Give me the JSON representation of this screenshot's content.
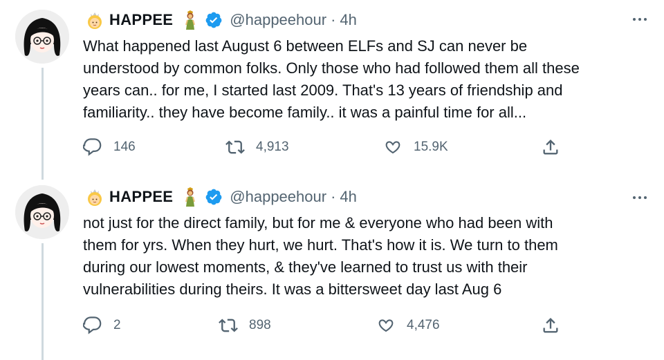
{
  "tweets": [
    {
      "display_name": "HAPPEE",
      "handle": "@happeehour",
      "separator": "·",
      "time": "4h",
      "text": "What happened last August 6 between ELFs and SJ can never be\nunderstood by common folks. Only those who had followed them all these\nyears can.. for me, I started last 2009. That's 13 years of friendship and\nfamiliarity.. they have become family.. it was a painful time for all...",
      "replies": "146",
      "retweets": "4,913",
      "likes": "15.9K"
    },
    {
      "display_name": "HAPPEE",
      "handle": "@happeehour",
      "separator": "·",
      "time": "4h",
      "text": "not just for the direct family, but for me & everyone who had been with\nthem for yrs. When they hurt, we hurt. That's how it is. We turn to them\nduring our lowest moments, & they've learned to trust us with their\nvulnerabilities during theirs. It was a bittersweet day last Aug 6",
      "replies": "2",
      "retweets": "898",
      "likes": "4,476"
    }
  ],
  "icons": {
    "avatar": "cartoon-girl-avatar",
    "emoji_before_name": "princess-emoji",
    "emoji_after_name": "woman-standing-emoji",
    "verified": "verified-badge-icon",
    "more": "more-dots-icon",
    "reply": "reply-icon",
    "retweet": "retweet-icon",
    "like": "heart-icon",
    "share": "share-icon"
  },
  "colors": {
    "text": "#0f1419",
    "secondary": "#536471",
    "verified": "#1d9bf0",
    "thread_line": "#cfd9de"
  }
}
